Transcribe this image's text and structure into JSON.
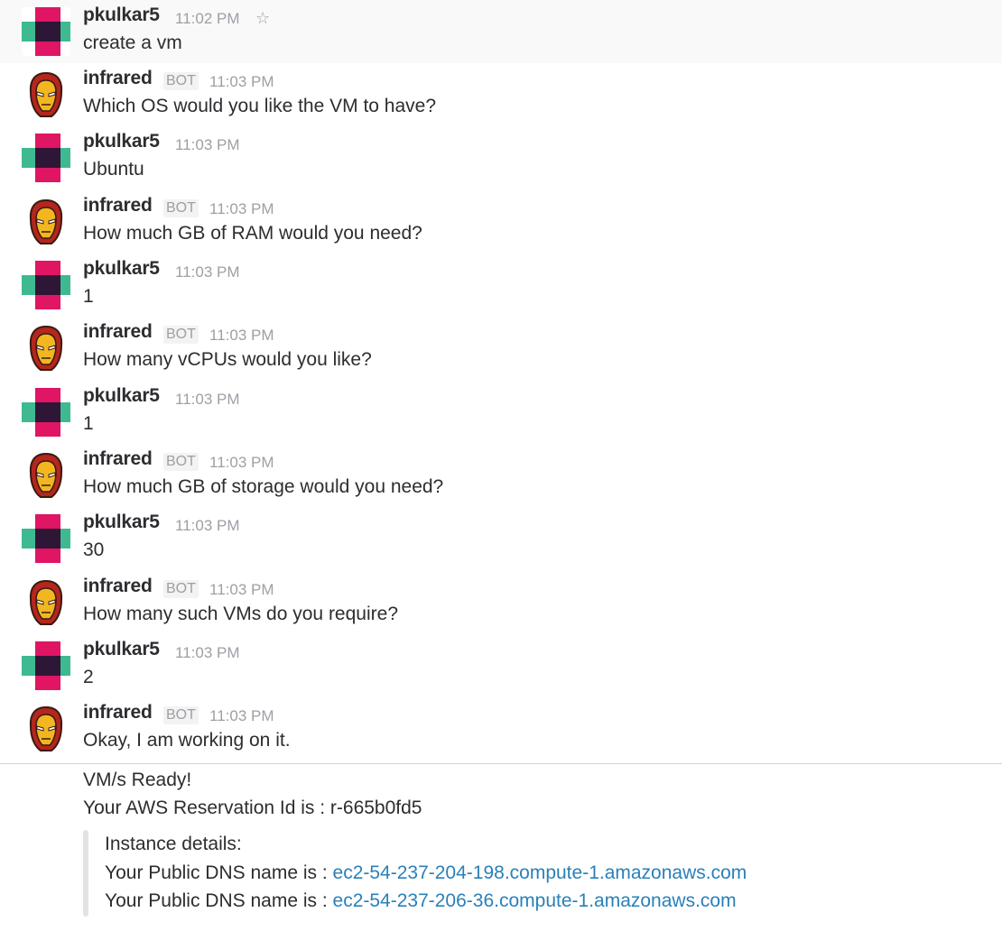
{
  "user_name": "pkulkar5",
  "bot_name": "infrared",
  "bot_badge": "BOT",
  "messages": [
    {
      "sender": "user",
      "time": "11:02 PM",
      "text": "create a vm",
      "starred_hover": true
    },
    {
      "sender": "bot",
      "time": "11:03 PM",
      "text": "Which OS would you like the VM to have?"
    },
    {
      "sender": "user",
      "time": "11:03 PM",
      "text": "Ubuntu"
    },
    {
      "sender": "bot",
      "time": "11:03 PM",
      "text": "How much GB of RAM would you need?"
    },
    {
      "sender": "user",
      "time": "11:03 PM",
      "text": "1"
    },
    {
      "sender": "bot",
      "time": "11:03 PM",
      "text": "How many vCPUs would you like?"
    },
    {
      "sender": "user",
      "time": "11:03 PM",
      "text": "1"
    },
    {
      "sender": "bot",
      "time": "11:03 PM",
      "text": "How much GB of storage would you need?"
    },
    {
      "sender": "user",
      "time": "11:03 PM",
      "text": "30"
    },
    {
      "sender": "bot",
      "time": "11:03 PM",
      "text": "How many such VMs do you require?"
    },
    {
      "sender": "user",
      "time": "11:03 PM",
      "text": "2"
    },
    {
      "sender": "bot",
      "time": "11:03 PM",
      "text": "Okay, I am working on it."
    }
  ],
  "followup": {
    "line1": "VM/s Ready!",
    "line2": "Your AWS Reservation Id is : r-665b0fd5",
    "attachment": {
      "title": "Instance details:",
      "dns_prefix": "Your Public DNS name is : ",
      "dns1": "ec2-54-237-204-198.compute-1.amazonaws.com",
      "dns2": "ec2-54-237-206-36.compute-1.amazonaws.com"
    }
  },
  "icons": {
    "star": "star-outline-icon",
    "user_avatar": "identicon-avatar",
    "bot_avatar": "iron-man-avatar"
  },
  "colors": {
    "link": "#2a80b9",
    "avatar_pink": "#e01563",
    "avatar_green": "#3eb991",
    "avatar_dark": "#2e1637"
  }
}
